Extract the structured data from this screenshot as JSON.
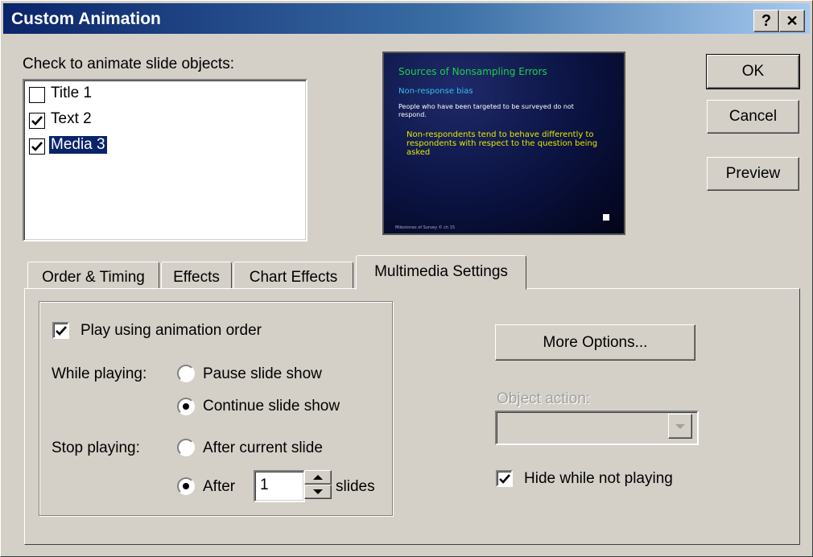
{
  "window": {
    "title": "Custom Animation",
    "help_glyph": "?",
    "close_glyph": "✕"
  },
  "objects_label": "Check to animate slide objects:",
  "objects": [
    {
      "label": "Title 1",
      "checked": false,
      "selected": false
    },
    {
      "label": "Text 2",
      "checked": true,
      "selected": false
    },
    {
      "label": "Media 3",
      "checked": true,
      "selected": true
    }
  ],
  "preview": {
    "title": "Sources of Nonsampling Errors",
    "subtitle": "Non-response bias",
    "body": "People who have been targeted to be surveyed do not respond.",
    "highlight": "Non-respondents tend to behave differently to respondents with respect to the question being asked",
    "footer": "Milestones of Survey © ch 15"
  },
  "buttons": {
    "ok": "OK",
    "cancel": "Cancel",
    "preview": "Preview",
    "more_options": "More Options..."
  },
  "tabs": [
    {
      "label": "Order & Timing",
      "active": false
    },
    {
      "label": "Effects",
      "active": false
    },
    {
      "label": "Chart Effects",
      "active": false
    },
    {
      "label": "Multimedia Settings",
      "active": true
    }
  ],
  "multimedia": {
    "play_order_label": "Play using animation order",
    "play_order_checked": true,
    "while_playing_label": "While playing:",
    "pause_label": "Pause slide show",
    "continue_label": "Continue slide show",
    "while_playing_value": "continue",
    "stop_playing_label": "Stop playing:",
    "after_current_label": "After current slide",
    "after_label": "After",
    "after_value": "1",
    "slides_label": "slides",
    "stop_playing_value": "after",
    "object_action_label": "Object action:",
    "object_action_value": "",
    "hide_label": "Hide while not playing",
    "hide_checked": true
  },
  "colors": {
    "titlebar": "#0a246a",
    "selection": "#0a246a",
    "preview_title": "#18d24a",
    "preview_sub": "#31c0f0",
    "preview_highlight": "#e8e800"
  }
}
